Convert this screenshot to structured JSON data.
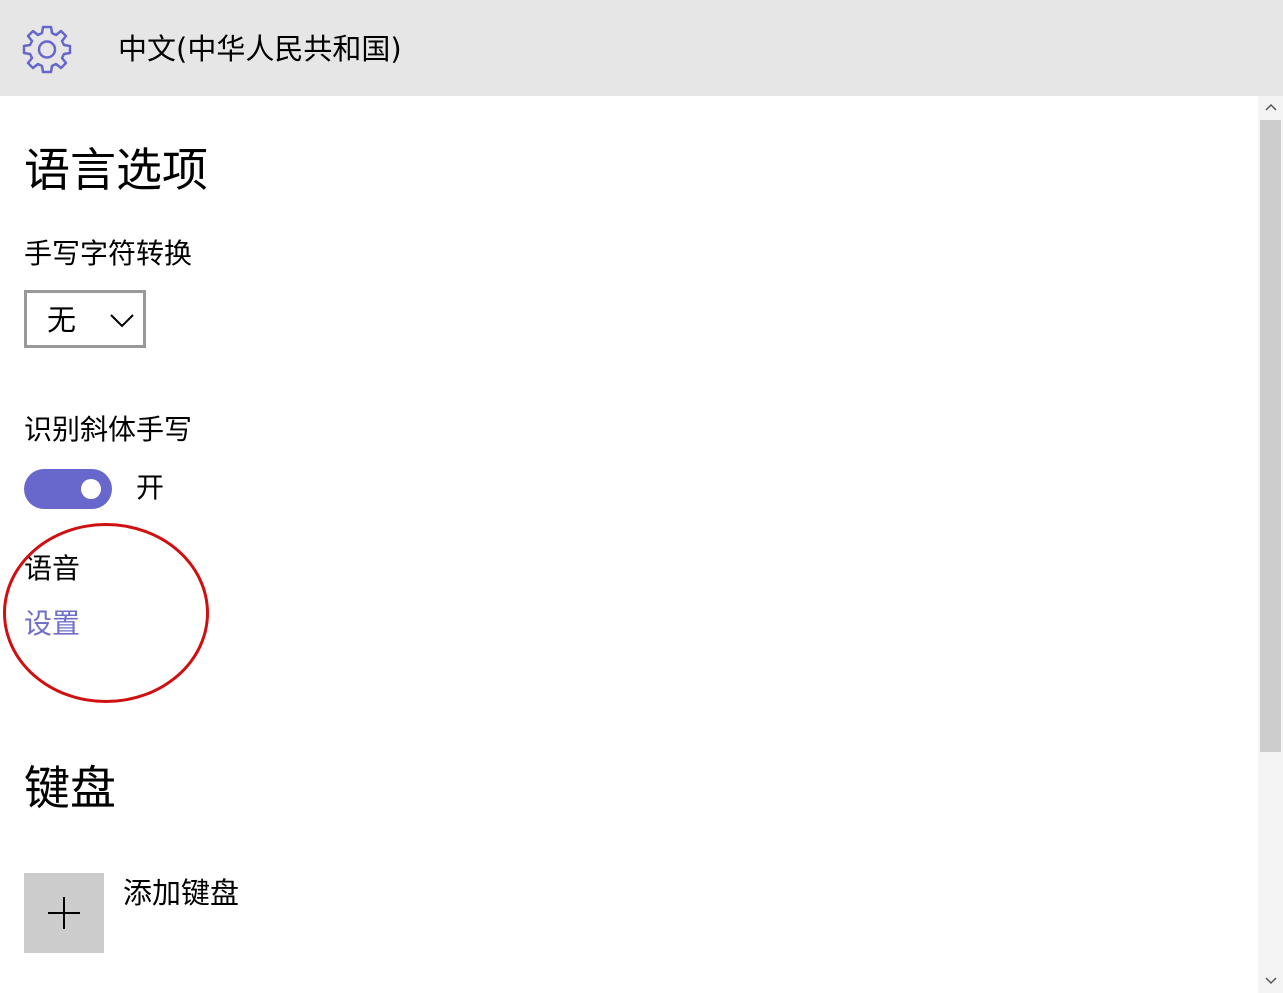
{
  "header": {
    "title": "中文(中华人民共和国)",
    "icon": "gear-icon"
  },
  "language_options": {
    "title": "语言选项",
    "handwriting_conversion": {
      "label": "手写字符转换",
      "selected": "无"
    },
    "italic_handwriting": {
      "label": "识别斜体手写",
      "state": "开",
      "on": true
    },
    "speech": {
      "label": "语音",
      "settings_link": "设置"
    }
  },
  "keyboard": {
    "title": "键盘",
    "add_label": "添加键盘"
  },
  "colors": {
    "accent": "#6868cc",
    "link": "#6f6fc8",
    "header_bg": "#e6e6e6",
    "annotation": "#d01010"
  }
}
